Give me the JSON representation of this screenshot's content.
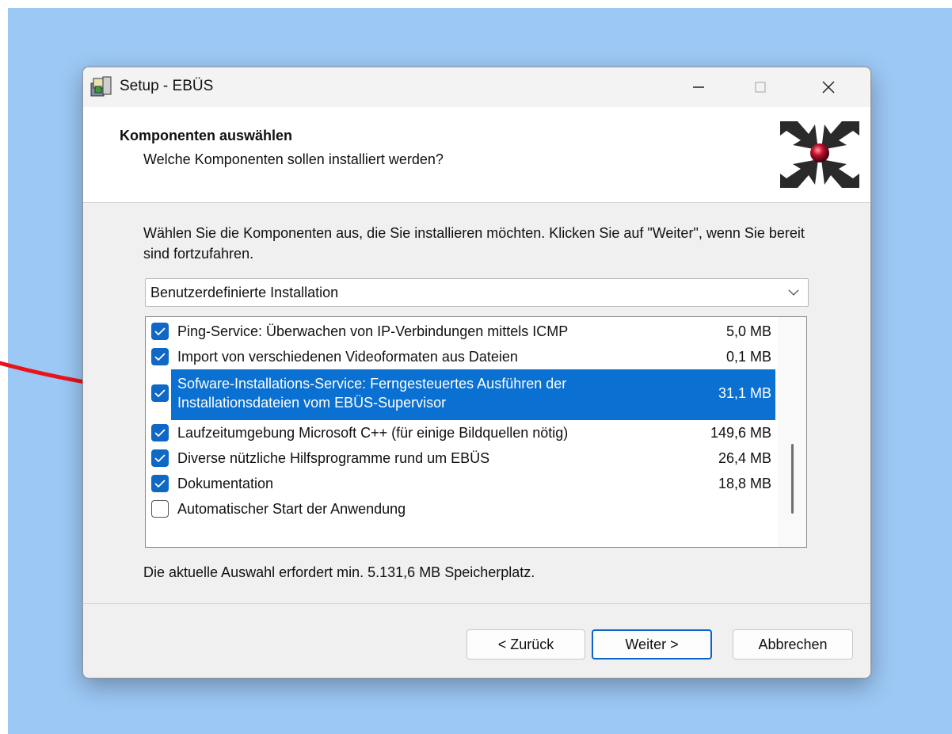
{
  "window": {
    "title": "Setup - EBÜS",
    "controls": {
      "minimize": "minimize",
      "maximize": "maximize",
      "close": "close"
    }
  },
  "header": {
    "title": "Komponenten auswählen",
    "subtitle": "Welche Komponenten sollen installiert werden?"
  },
  "body": {
    "description": "Wählen Sie die Komponenten aus, die Sie installieren möchten. Klicken Sie auf \"Weiter\", wenn Sie bereit sind fortzufahren.",
    "install_type": {
      "selected": "Benutzerdefinierte Installation"
    },
    "components": [
      {
        "label": "Ping-Service: Überwachen von IP-Verbindungen mittels ICMP",
        "size": "5,0 MB",
        "checked": true,
        "selected": false
      },
      {
        "label": "Import von verschiedenen Videoformaten aus Dateien",
        "size": "0,1 MB",
        "checked": true,
        "selected": false
      },
      {
        "label": "Sofware-Installations-Service: Ferngesteuertes Ausführen der",
        "label_line2": "Installationsdateien vom EBÜS-Supervisor",
        "size": "31,1 MB",
        "checked": true,
        "selected": true
      },
      {
        "label": "Laufzeitumgebung Microsoft C++ (für einige Bildquellen nötig)",
        "size": "149,6 MB",
        "checked": true,
        "selected": false
      },
      {
        "label": "Diverse nützliche Hilfsprogramme rund um EBÜS",
        "size": "26,4 MB",
        "checked": true,
        "selected": false
      },
      {
        "label": "Dokumentation",
        "size": "18,8 MB",
        "checked": true,
        "selected": false
      },
      {
        "label": "Automatischer Start der Anwendung",
        "size": "",
        "checked": false,
        "selected": false
      }
    ],
    "space_required": "Die aktuelle Auswahl erfordert min. 5.131,6 MB Speicherplatz."
  },
  "buttons": {
    "back": "< Zurück",
    "next": "Weiter >",
    "cancel": "Abbrechen"
  },
  "colors": {
    "desktop": "#9cc8f5",
    "selection": "#0a70d2",
    "checkbox": "#0f67c6",
    "annotation_arrow": "#e8141a"
  },
  "icons": [
    "setup-app-icon",
    "ebus-logo",
    "chevron-down-icon",
    "checkmark-icon",
    "annotation-arrow"
  ]
}
